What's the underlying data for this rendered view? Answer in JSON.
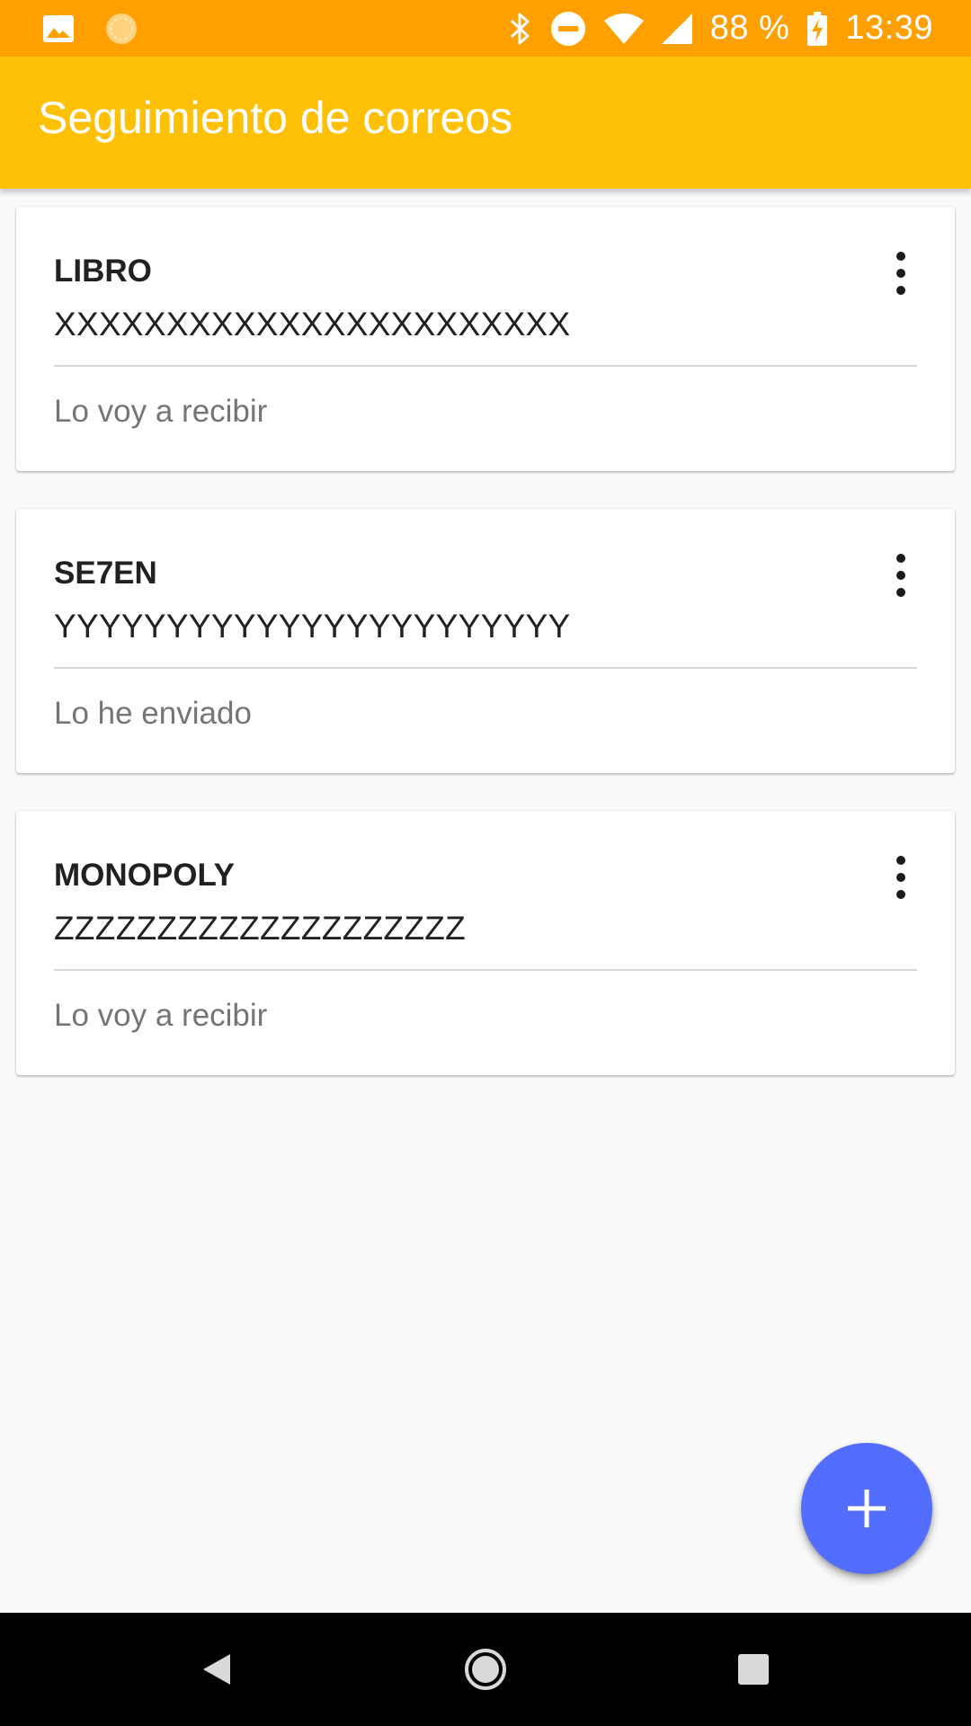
{
  "status_bar": {
    "battery_percent": "88 %",
    "time": "13:39",
    "background": "#ffa000",
    "left_icons": [
      "image-icon",
      "sync-icon"
    ],
    "right_icons": [
      "bluetooth-icon",
      "do-not-disturb-icon",
      "wifi-icon",
      "signal-icon",
      "battery-charging-icon"
    ]
  },
  "app_bar": {
    "title": "Seguimiento de correos",
    "background": "#ffc107"
  },
  "shipments": [
    {
      "name": "LIBRO",
      "code": "XXXXXXXXXXXXXXXXXXXXXXX",
      "status": "Lo voy a recibir"
    },
    {
      "name": "SE7EN",
      "code": "YYYYYYYYYYYYYYYYYYYYYYY",
      "status": "Lo he enviado"
    },
    {
      "name": "MONOPOLY",
      "code": "ZZZZZZZZZZZZZZZZZZZZ",
      "status": "Lo voy a recibir"
    }
  ],
  "fab": {
    "icon": "plus-icon",
    "color": "#536dfe"
  },
  "nav_bar": {
    "icons": [
      "back-icon",
      "home-icon",
      "recents-icon"
    ]
  }
}
